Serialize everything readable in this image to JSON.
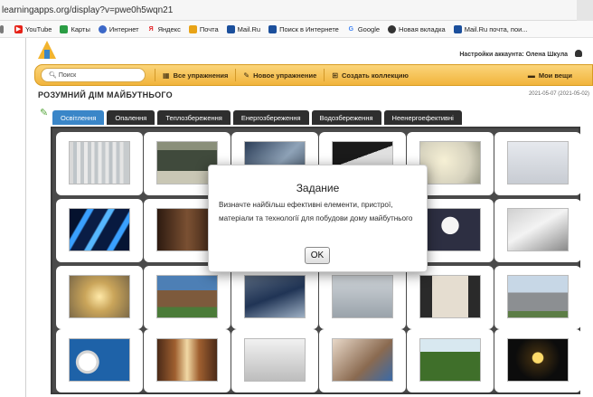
{
  "browser": {
    "url": "learningapps.org/display?v=pwe0h5wqn21"
  },
  "bookmarks": [
    {
      "label": "",
      "icon": "grid-icon",
      "color": "#7a7a7a"
    },
    {
      "label": "YouTube",
      "icon": "youtube-icon",
      "color": "#e62117"
    },
    {
      "label": "Карты",
      "icon": "maps-icon",
      "color": "#2a9d44"
    },
    {
      "label": "Интернет",
      "icon": "globe-icon",
      "color": "#3c68c8"
    },
    {
      "label": "Яндекс",
      "icon": "yandex-icon",
      "color": "#e3262a"
    },
    {
      "label": "Почта",
      "icon": "mail-icon",
      "color": "#e8a316"
    },
    {
      "label": "Mail.Ru",
      "icon": "mailru-icon",
      "color": "#1b4f9c"
    },
    {
      "label": "Поиск в Интернете",
      "icon": "search-page-icon",
      "color": "#1b4f9c"
    },
    {
      "label": "Google",
      "icon": "google-icon",
      "color": "#4285f4"
    },
    {
      "label": "Новая вкладка",
      "icon": "newtab-icon",
      "color": "#333333"
    },
    {
      "label": "Mail.Ru почта, пои...",
      "icon": "mailru-icon",
      "color": "#1b4f9c"
    }
  ],
  "header": {
    "account_label": "Настройки аккаунта: Олена Шкула"
  },
  "navbar": {
    "search_placeholder": "Поиск",
    "all_exercises": "Все упражнения",
    "new_exercise": "Новое упражнение",
    "create_collection": "Создать коллекцию",
    "my_exercises": "Мои вещи"
  },
  "page": {
    "title": "РОЗУМНИЙ ДІМ МАЙБУТНЬОГО",
    "date": "2021-05-07 (2021-05-02)"
  },
  "tabs": [
    {
      "label": "Освітлення",
      "active": true
    },
    {
      "label": "Опалення",
      "active": false
    },
    {
      "label": "Теплозбереження",
      "active": false
    },
    {
      "label": "Енергозбереження",
      "active": false
    },
    {
      "label": "Водозбереження",
      "active": false
    },
    {
      "label": "Неенергоефективні",
      "active": false
    }
  ],
  "modal": {
    "title": "Задание",
    "text": "Визначте найбільш ефективні елементи, пристрої, матеріали та технології для побудови дому майбутнього",
    "ok_label": "OK"
  },
  "colors": {
    "tab_active": "#3a86c8",
    "tab_inactive": "#2e2e2e",
    "navbar": "#f1b43c",
    "board": "#4a4a4a"
  }
}
